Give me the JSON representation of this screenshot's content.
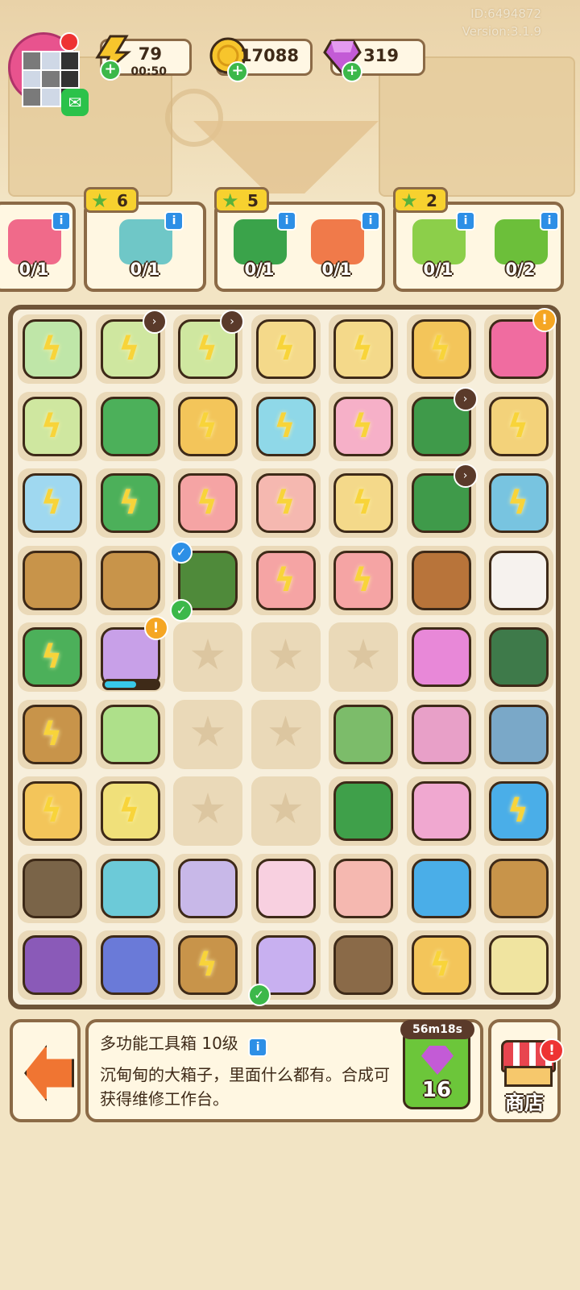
{
  "header": {
    "player_id": "ID:6494872",
    "version": "Version:3.1.9",
    "energy": {
      "value": "79",
      "timer": "00:50"
    },
    "coins": "17088",
    "gems": "319"
  },
  "orders": [
    {
      "reward": "",
      "items": [
        {
          "name": "flower-bouquet",
          "count": "0/1",
          "color": "#f06a8a"
        }
      ]
    },
    {
      "reward": "6",
      "items": [
        {
          "name": "exercise-bike",
          "count": "0/1",
          "color": "#6fc7c7"
        }
      ]
    },
    {
      "reward": "5",
      "items": [
        {
          "name": "green-drill",
          "count": "0/1",
          "color": "#3aa34a"
        },
        {
          "name": "soda-can",
          "count": "0/1",
          "color": "#f07a4a"
        }
      ]
    },
    {
      "reward": "2",
      "items": [
        {
          "name": "seedling-pot",
          "count": "0/1",
          "color": "#8ccf4a"
        },
        {
          "name": "orange-tree",
          "count": "0/2",
          "color": "#6cbf3a"
        }
      ]
    }
  ],
  "board": {
    "rows": [
      [
        {
          "t": "item",
          "c": "#bfe6a8",
          "g": 1
        },
        {
          "t": "item",
          "c": "#cfe7a0",
          "g": 1,
          "clock": 1
        },
        {
          "t": "item",
          "c": "#cfe7a0",
          "g": 1,
          "clock": 1
        },
        {
          "t": "item",
          "c": "#f4d98a",
          "g": 1
        },
        {
          "t": "item",
          "c": "#f4d98a",
          "g": 1
        },
        {
          "t": "item",
          "c": "#f3c55a",
          "g": 1
        },
        {
          "t": "item",
          "c": "#f06ca0",
          "alert": 1
        }
      ],
      [
        {
          "t": "item",
          "c": "#cfe7a0",
          "g": 1
        },
        {
          "t": "item",
          "c": "#4cb05a"
        },
        {
          "t": "item",
          "c": "#f3c55a",
          "g": 1
        },
        {
          "t": "item",
          "c": "#8fd8e8",
          "g": 1
        },
        {
          "t": "item",
          "c": "#f6b0c8",
          "g": 1
        },
        {
          "t": "item",
          "c": "#3f9a4a",
          "clock": 1
        },
        {
          "t": "item",
          "c": "#f3d27a",
          "g": 1
        }
      ],
      [
        {
          "t": "item",
          "c": "#9fd8f0",
          "g": 1
        },
        {
          "t": "item",
          "c": "#4cb05a",
          "g": 1
        },
        {
          "t": "item",
          "c": "#f5a4a4",
          "g": 1
        },
        {
          "t": "item",
          "c": "#f5b8b0",
          "g": 1
        },
        {
          "t": "item",
          "c": "#f4d98a",
          "g": 1
        },
        {
          "t": "item",
          "c": "#3f9a4a",
          "clock": 1
        },
        {
          "t": "item",
          "c": "#78c4e0",
          "g": 1
        }
      ],
      [
        {
          "t": "item",
          "c": "#c8944a"
        },
        {
          "t": "item",
          "c": "#c8944a"
        },
        {
          "t": "item",
          "c": "#4f8a3a",
          "check": "blue",
          "check2": 1
        },
        {
          "t": "item",
          "c": "#f5a4a4",
          "g": 1
        },
        {
          "t": "item",
          "c": "#f5a4a4",
          "g": 1
        },
        {
          "t": "item",
          "c": "#b8743a"
        },
        {
          "t": "item",
          "c": "#f6f2ee"
        }
      ],
      [
        {
          "t": "item",
          "c": "#4cb05a",
          "g": 1
        },
        {
          "t": "item",
          "c": "#c8a0e8",
          "alert": 1,
          "progress": 0.6
        },
        {
          "t": "empty"
        },
        {
          "t": "empty"
        },
        {
          "t": "empty"
        },
        {
          "t": "item",
          "c": "#e888d8"
        },
        {
          "t": "item",
          "c": "#3e7a4a"
        }
      ],
      [
        {
          "t": "item",
          "c": "#c8944a",
          "g": 1
        },
        {
          "t": "item",
          "c": "#aee08a"
        },
        {
          "t": "empty"
        },
        {
          "t": "empty"
        },
        {
          "t": "item",
          "c": "#7cbc6a"
        },
        {
          "t": "item",
          "c": "#e8a0c8"
        },
        {
          "t": "item",
          "c": "#7aa8c8"
        }
      ],
      [
        {
          "t": "item",
          "c": "#f3c55a",
          "g": 1
        },
        {
          "t": "item",
          "c": "#f0e07a",
          "g": 1
        },
        {
          "t": "empty"
        },
        {
          "t": "empty"
        },
        {
          "t": "item",
          "c": "#3fa04a"
        },
        {
          "t": "item",
          "c": "#f0a8d0"
        },
        {
          "t": "item",
          "c": "#4aaee8",
          "g": 1
        }
      ],
      [
        {
          "t": "item",
          "c": "#7a6448"
        },
        {
          "t": "item",
          "c": "#6ccad8"
        },
        {
          "t": "item",
          "c": "#c8b8e8"
        },
        {
          "t": "item",
          "c": "#f8d0e0"
        },
        {
          "t": "item",
          "c": "#f5b8b0"
        },
        {
          "t": "item",
          "c": "#4aaee8"
        },
        {
          "t": "item",
          "c": "#c8944a"
        }
      ],
      [
        {
          "t": "item",
          "c": "#8a5ab8"
        },
        {
          "t": "item",
          "c": "#6a7ad8"
        },
        {
          "t": "item",
          "c": "#c8944a",
          "g": 1
        },
        {
          "t": "item",
          "c": "#c8b0f0",
          "check": "green"
        },
        {
          "t": "item",
          "c": "#8a6a48"
        },
        {
          "t": "item",
          "c": "#f3c55a",
          "g": 1
        },
        {
          "t": "item",
          "c": "#f0e4a0"
        }
      ]
    ]
  },
  "selected": {
    "name": "多功能工具箱 10级",
    "description": "沉甸甸的大箱子，里面什么都有。合成可获得维修工作台。",
    "timer": "56m18s",
    "price": "16"
  },
  "shop_label": "商店",
  "colors": {
    "accent_border": "#8b6a46",
    "panel": "#fff7e2",
    "board_bg": "#f7efdc",
    "gem": "#c35bd6"
  },
  "icons": {
    "energy": "lightning-icon",
    "coins": "coin-icon",
    "gems": "gem-icon",
    "exit": "exit-arrow-icon",
    "shop": "shop-icon",
    "info": "info-icon"
  }
}
